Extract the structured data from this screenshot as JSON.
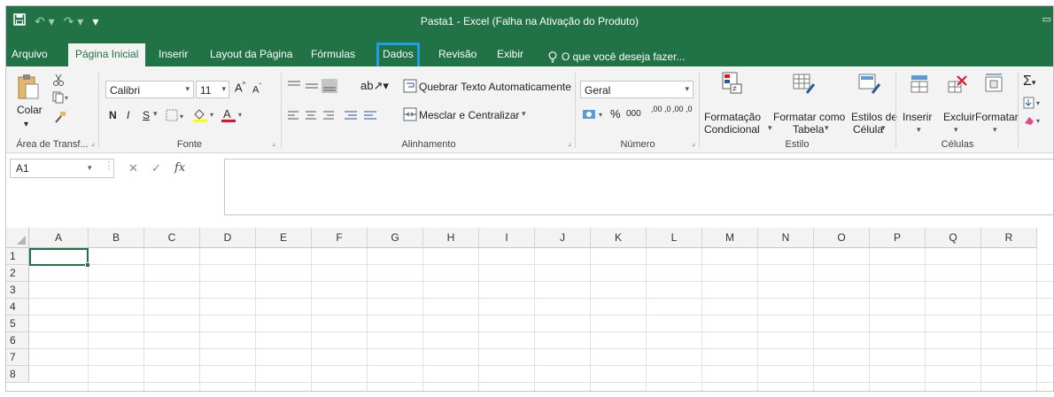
{
  "window": {
    "title": "Pasta1 - Excel (Falha na Ativação do Produto)",
    "qat": {
      "save_icon": "save-icon",
      "undo": "↶ ▾",
      "redo": "↷ ▾",
      "customize": "⇌"
    }
  },
  "tabs": [
    {
      "label": "Arquivo"
    },
    {
      "label": "Página Inicial"
    },
    {
      "label": "Inserir"
    },
    {
      "label": "Layout da Página"
    },
    {
      "label": "Fórmulas"
    },
    {
      "label": "Dados"
    },
    {
      "label": "Revisão"
    },
    {
      "label": "Exibir"
    },
    {
      "label": "O que você deseja fazer..."
    }
  ],
  "ribbon": {
    "clipboard": {
      "label": "Área de Transf...",
      "paste": "Colar"
    },
    "font": {
      "label": "Fonte",
      "name": "Calibri",
      "size": "11",
      "bold": "N",
      "italic": "I",
      "underline": "S"
    },
    "alignment": {
      "label": "Alinhamento",
      "wrap": "Quebrar Texto Automaticamente",
      "merge": "Mesclar e Centralizar"
    },
    "number": {
      "label": "Número",
      "format": "Geral",
      "percent": "%",
      "thousands": "000",
      "inc_dec": ",00 ,0",
      "dec_dec": ",00 ,0"
    },
    "styles": {
      "label": "Estilo",
      "conditional_1": "Formatação",
      "conditional_2": "Condicional",
      "table_1": "Formatar como",
      "table_2": "Tabela",
      "cell_1": "Estilos de",
      "cell_2": "Célula"
    },
    "cells": {
      "label": "Células",
      "insert": "Inserir",
      "delete": "Excluir",
      "format": "Formatar"
    }
  },
  "formula_bar": {
    "name_box": "A1",
    "fx": "fx",
    "value": ""
  },
  "sheet": {
    "columns": [
      "A",
      "B",
      "C",
      "D",
      "E",
      "F",
      "G",
      "H",
      "I",
      "J",
      "K",
      "L",
      "M",
      "N",
      "O",
      "P",
      "Q",
      "R"
    ],
    "rows": [
      "1",
      "2",
      "3",
      "4",
      "5",
      "6",
      "7",
      "8"
    ],
    "selected_cell": "A1"
  },
  "colors": {
    "brand": "#217346",
    "highlight": "#1ba1e2"
  }
}
